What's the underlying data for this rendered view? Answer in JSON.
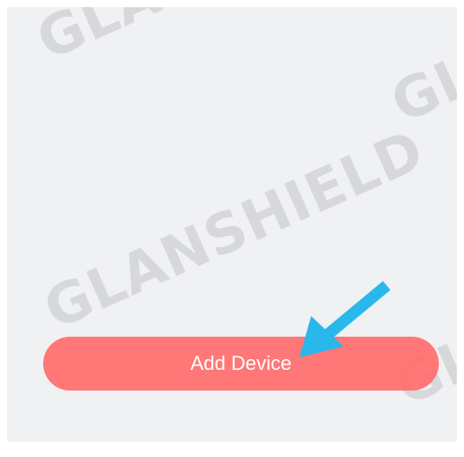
{
  "watermark": {
    "text": "GLANSHIELD"
  },
  "add_device": {
    "label": "Add Device"
  },
  "colors": {
    "screen_background": "#f0f1f3",
    "button": "#ff7070",
    "button_text": "#ffffff",
    "annotation_arrow": "#29b8ec"
  },
  "icons": {
    "annotation": "arrow-pointer-icon"
  }
}
